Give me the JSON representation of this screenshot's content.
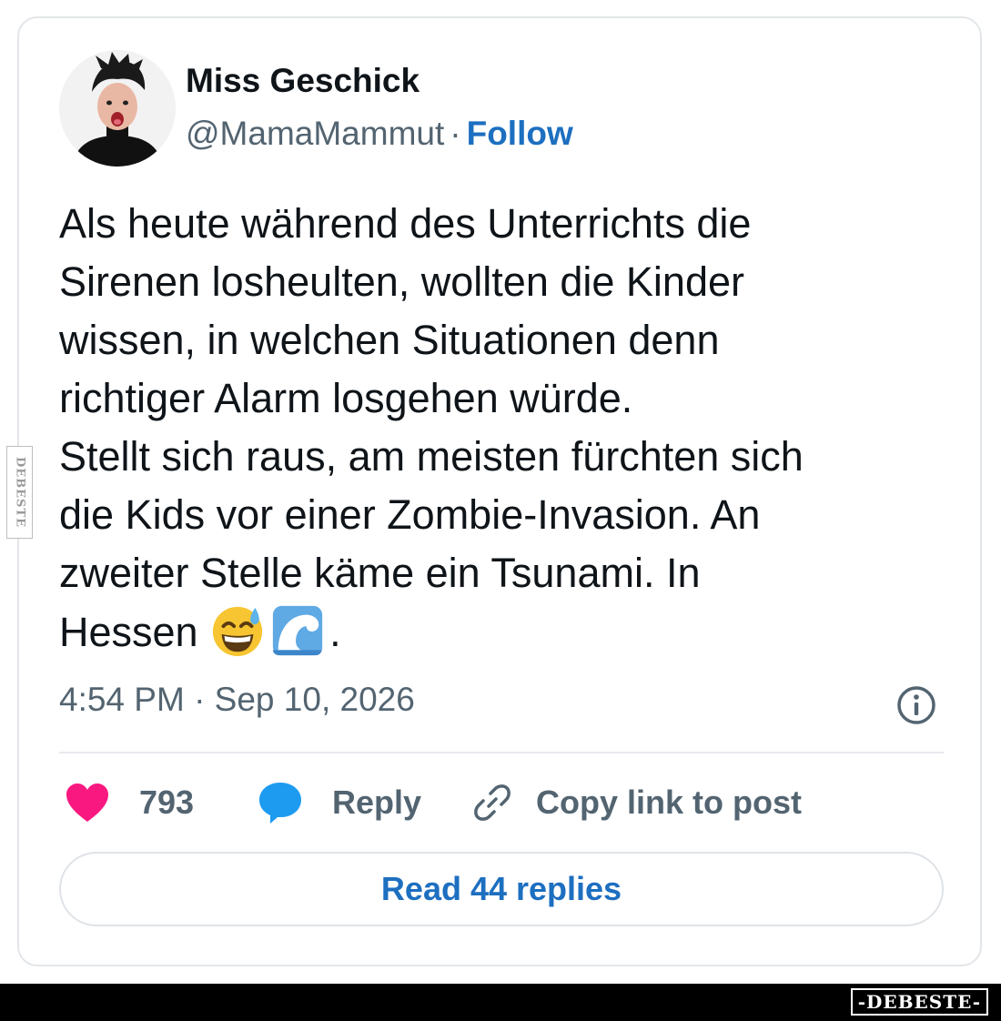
{
  "post": {
    "author_name": "Miss Geschick",
    "handle": "@MamaMammut",
    "separator": "·",
    "follow_label": "Follow",
    "text_lines": [
      "Als heute während des Unterrichts die",
      "Sirenen losheulten, wollten die Kinder",
      "wissen, in welchen Situationen denn",
      "richtiger Alarm losgehen würde.",
      "Stellt sich raus, am meisten fürchten sich",
      "die Kids vor einer Zombie-Invasion. An",
      "zweiter Stelle käme ein Tsunami. In"
    ],
    "last_line_text": "Hessen",
    "last_line_end": ".",
    "emojis": [
      "grinning-sweat-emoji",
      "water-wave-emoji"
    ],
    "timestamp": "4:54 PM · Sep 10, 2026"
  },
  "actions": {
    "like_count": "793",
    "reply_label": "Reply",
    "copy_link_label": "Copy link to post"
  },
  "read_replies_label": "Read 44 replies",
  "watermark": {
    "side": "DEBESTE",
    "bottom": "-DEBESTE-"
  },
  "colors": {
    "link_blue": "#1d6fc0",
    "heart_pink": "#f91880",
    "reply_bubble_blue": "#1d9bf0",
    "text_primary": "#0f1419",
    "text_secondary": "#536471"
  },
  "icons": {
    "info": "info-circle-icon",
    "like": "heart-icon",
    "reply": "speech-bubble-icon",
    "copy_link": "link-icon"
  }
}
